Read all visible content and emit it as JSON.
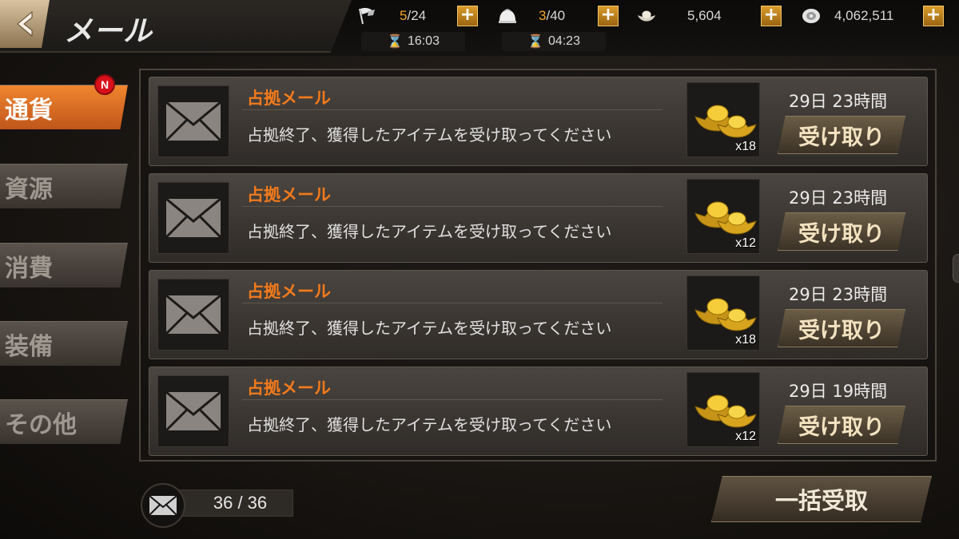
{
  "header": {
    "title": "メール",
    "resources": [
      {
        "icon": "flag-icon",
        "current": "5",
        "max": "/24",
        "timer": "16:03"
      },
      {
        "icon": "bun-icon",
        "current": "3",
        "max": "/40",
        "timer": "04:23"
      },
      {
        "icon": "gold-ingot-icon",
        "value": "5,604"
      },
      {
        "icon": "silver-coin-icon",
        "value": "4,062,511"
      }
    ],
    "plus_label": "+"
  },
  "tabs": [
    {
      "label": "通貨",
      "active": true,
      "badge": "N"
    },
    {
      "label": "資源"
    },
    {
      "label": "消費"
    },
    {
      "label": "装備"
    },
    {
      "label": "その他"
    }
  ],
  "mails": [
    {
      "title": "占拠メール",
      "body": "占拠終了、獲得したアイテムを受け取ってください",
      "reward_icon": "gold-ingot-icon",
      "quantity": "x18",
      "time_left": "29日 23時間",
      "claim_label": "受け取り"
    },
    {
      "title": "占拠メール",
      "body": "占拠終了、獲得したアイテムを受け取ってください",
      "reward_icon": "gold-ingot-icon",
      "quantity": "x12",
      "time_left": "29日 23時間",
      "claim_label": "受け取り"
    },
    {
      "title": "占拠メール",
      "body": "占拠終了、獲得したアイテムを受け取ってください",
      "reward_icon": "gold-ingot-icon",
      "quantity": "x18",
      "time_left": "29日 23時間",
      "claim_label": "受け取り"
    },
    {
      "title": "占拠メール",
      "body": "占拠終了、獲得したアイテムを受け取ってください",
      "reward_icon": "gold-ingot-icon",
      "quantity": "x12",
      "time_left": "29日 19時間",
      "claim_label": "受け取り"
    }
  ],
  "footer": {
    "mail_count": "36 / 36",
    "claim_all_label": "一括受取"
  },
  "colors": {
    "accent_orange": "#f27a1c",
    "tab_active": "#e0702a",
    "badge_red": "#d8101a",
    "resource_highlight": "#f3a22c"
  }
}
